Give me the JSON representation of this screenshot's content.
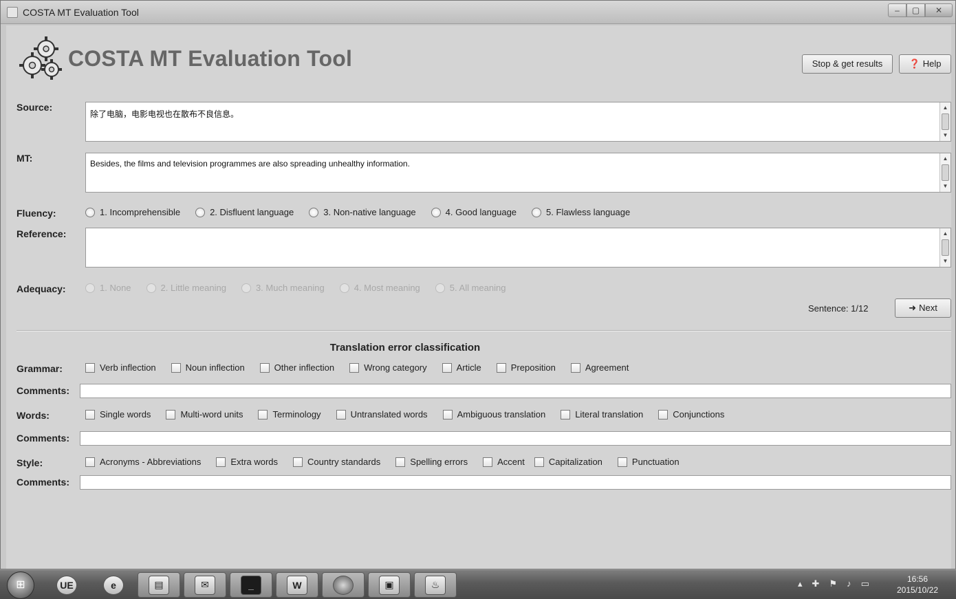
{
  "window": {
    "title": "COSTA MT Evaluation Tool",
    "controls": {
      "minimize": "–",
      "maximize": "▢",
      "close": "✕"
    }
  },
  "header": {
    "app_title": "COSTA MT Evaluation Tool",
    "logo_icon": "gears-icon",
    "stop_button": "Stop & get results",
    "help_button": "Help"
  },
  "source": {
    "label": "Source:",
    "text": "除了电脑，电影电视也在散布不良信息。"
  },
  "mt": {
    "label": "MT:",
    "text": "Besides, the films and television programmes are also spreading unhealthy information."
  },
  "fluency": {
    "label": "Fluency:",
    "options": [
      "1. Incomprehensible",
      "2. Disfluent language",
      "3. Non-native language",
      "4. Good language",
      "5.  Flawless language"
    ]
  },
  "reference": {
    "label": "Reference:",
    "text": ""
  },
  "adequacy": {
    "label": "Adequacy:",
    "options": [
      "1. None",
      "2. Little meaning",
      "3. Much meaning",
      "4. Most meaning",
      "5. All meaning"
    ]
  },
  "navigation": {
    "sentence": "Sentence: 1/12",
    "next_button": "Next"
  },
  "error_classification": {
    "title": "Translation error classification",
    "grammar": {
      "label": "Grammar:",
      "options": [
        "Verb inflection",
        "Noun inflection",
        "Other inflection",
        "Wrong category",
        "Article",
        "Preposition",
        "Agreement"
      ]
    },
    "words": {
      "label": "Words:",
      "options": [
        "Single words",
        "Multi-word units",
        "Terminology",
        "Untranslated words",
        "Ambiguous translation",
        "Literal translation",
        "Conjunctions"
      ]
    },
    "style": {
      "label": "Style:",
      "options": [
        "Acronyms - Abbreviations",
        "Extra words",
        "Country standards",
        "Spelling errors",
        "Accent",
        "Capitalization",
        "Punctuation"
      ]
    },
    "comments_label": "Comments:"
  },
  "taskbar": {
    "items": [
      "start-orb",
      "ultraedit-icon",
      "internet-explorer-icon",
      "file-manager-icon",
      "mail-icon",
      "terminal-icon",
      "word-icon",
      "firefox-icon",
      "control-panel-icon",
      "java-icon"
    ],
    "clock_time": "16:56",
    "clock_date": "2015/10/22"
  }
}
